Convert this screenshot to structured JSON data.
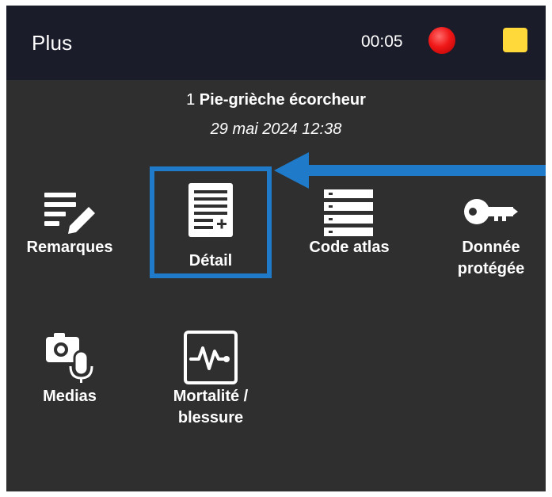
{
  "header": {
    "title": "Plus",
    "timer": "00:05"
  },
  "observation": {
    "count": "1",
    "species": "Pie-grièche écorcheur",
    "date": "29 mai 2024 12:38"
  },
  "actions": [
    {
      "label": "Remarques",
      "icon": "notes-edit-icon"
    },
    {
      "label": "Détail",
      "icon": "document-add-icon",
      "highlighted": true
    },
    {
      "label": "Code atlas",
      "icon": "list-icon"
    },
    {
      "label_line1": "Donnée",
      "label_line2": "protégée",
      "icon": "key-icon"
    },
    {
      "label": "Medias",
      "icon": "camera-mic-icon"
    },
    {
      "label_line1": "Mortalité /",
      "label_line2": "blessure",
      "icon": "pulse-icon"
    }
  ],
  "colors": {
    "background": "#2f2f2f",
    "topbar": "#1b1c2a",
    "highlight": "#1f7bc9",
    "record": "#f01818",
    "stop": "#ffd83a"
  }
}
